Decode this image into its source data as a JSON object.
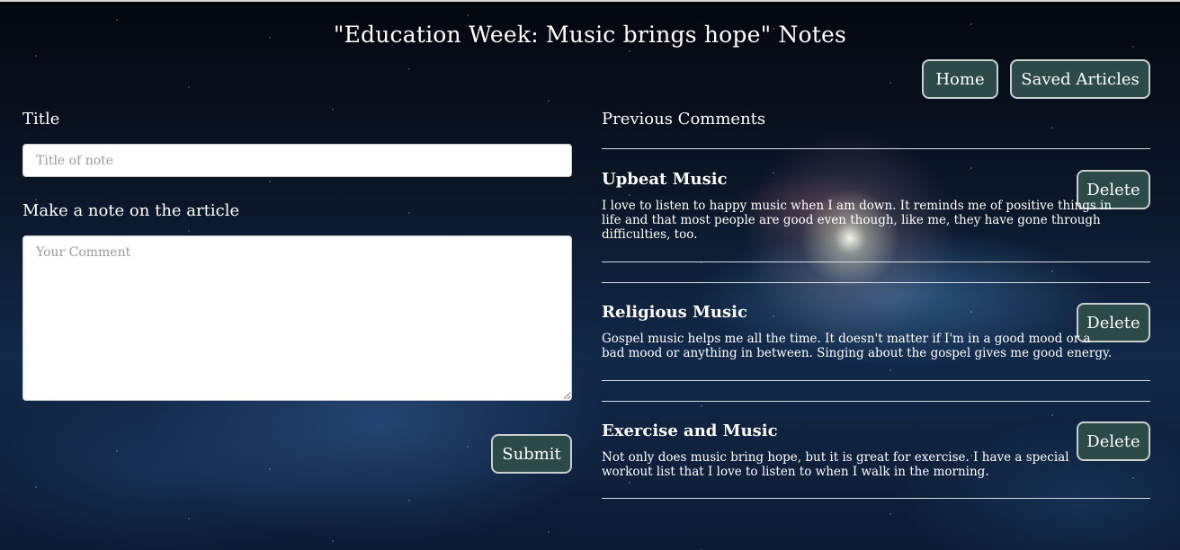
{
  "header": {
    "title": "\"Education Week: Music brings hope\" Notes"
  },
  "nav": {
    "home_label": "Home",
    "saved_label": "Saved Articles"
  },
  "form": {
    "title_label": "Title",
    "title_placeholder": "Title of note",
    "title_value": "",
    "note_label": "Make a note on the article",
    "note_placeholder": "Your Comment",
    "note_value": "",
    "submit_label": "Submit"
  },
  "comments": {
    "heading": "Previous Comments",
    "delete_label": "Delete",
    "items": [
      {
        "title": "Upbeat Music",
        "body": "I love to listen to happy music when I am down. It reminds me of positive things in life and that most people are good even though, like me, they have gone through difficulties, too."
      },
      {
        "title": "Religious Music",
        "body": "Gospel music helps me all the time. It doesn't matter if I'm in a good mood or a bad mood or anything in between. Singing about the gospel gives me good energy."
      },
      {
        "title": "Exercise and Music",
        "body": "Not only does music bring hope, but it is great for exercise. I have a special workout list that I love to listen to when I walk in the morning."
      }
    ]
  },
  "colors": {
    "button_bg": "#2c4a47",
    "button_border": "#c9cfcf",
    "text": "#ffffff"
  }
}
